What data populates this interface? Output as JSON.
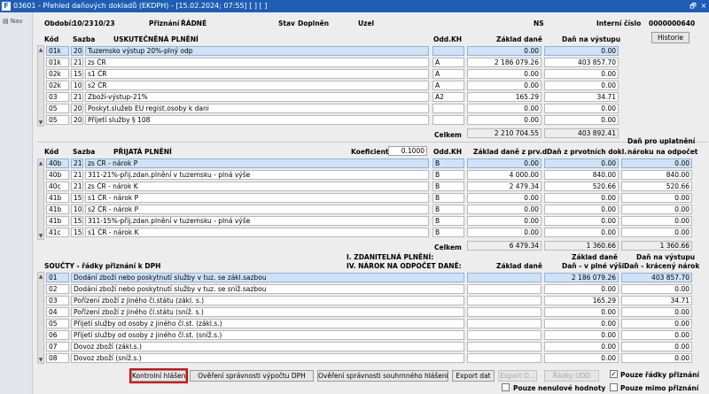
{
  "window": {
    "logo": "F",
    "title": "03601 - Přehled daňových dokladů (EKDPH) - [15.02.2024; 07:55]  [ ]  [ ]",
    "restore_symbol": "🗗",
    "close_symbol": "×"
  },
  "sidebar": {
    "nav_label": "Nav"
  },
  "header": {
    "obdobi_label": "Období:",
    "obdobi_from": "10/23",
    "obdobi_to": "10/23",
    "priznani_label": "Přiznání",
    "priznani_value": "ŘÁDNÉ",
    "stav_label": "Stav",
    "stav_value": "Doplněn",
    "uzel_label": "Uzel",
    "ns_label": "NS",
    "interni_label": "Interní číslo",
    "interni_value": "0000000640",
    "historie_button": "Historie"
  },
  "section1": {
    "col_kod": "Kód",
    "col_sazba": "Sazba",
    "col_title": "USKUTEČNĚNÁ PLNĚNÍ",
    "col_oddkh": "Odd.KH",
    "col_zaklad": "Základ daně",
    "col_dan": "Daň na výstupu",
    "rows": [
      {
        "kod": "01k",
        "sazba": "20",
        "popis": "Tuzemsko výstup 20%-plný odp",
        "odd": "",
        "zaklad": "0.00",
        "dan": "0.00"
      },
      {
        "kod": "01k",
        "sazba": "21",
        "popis": "zs ČR",
        "odd": "A",
        "zaklad": "2 186 079.26",
        "dan": "403 857.70"
      },
      {
        "kod": "02k",
        "sazba": "15",
        "popis": "s1 ČR",
        "odd": "A",
        "zaklad": "0.00",
        "dan": "0.00"
      },
      {
        "kod": "02k",
        "sazba": "10",
        "popis": "s2 ČR",
        "odd": "A",
        "zaklad": "0.00",
        "dan": "0.00"
      },
      {
        "kod": "03",
        "sazba": "21",
        "popis": "Zboží-výstup-21%",
        "odd": "A2",
        "zaklad": "165.29",
        "dan": "34.71"
      },
      {
        "kod": "05",
        "sazba": "20",
        "popis": "Poskyt.služeb EU regist.osoby k dani",
        "odd": "",
        "zaklad": "0.00",
        "dan": "0.00"
      },
      {
        "kod": "05",
        "sazba": "20",
        "popis": "Přijetí služby § 108",
        "odd": "",
        "zaklad": "0.00",
        "dan": "0.00"
      }
    ],
    "celkem_label": "Celkem",
    "celkem_zaklad": "2 210 704.55",
    "celkem_dan": "403 892.41"
  },
  "section2": {
    "col_kod": "Kód",
    "col_sazba": "Sazba",
    "col_title": "PŘIJATÁ PLNĚNÍ",
    "koef_label": "Koeficient",
    "koef_value": "0.1000",
    "col_oddkh": "Odd.KH",
    "col_zaklad": "Základ daně z prv.d.",
    "col_dan": "Daň z prvotních dokl.",
    "col_odpocet_1": "Daň pro uplatnění",
    "col_odpocet_2": "nároku na odpočet",
    "rows": [
      {
        "kod": "40b",
        "sazba": "21",
        "popis": "zs ČR - nárok P",
        "odd": "B",
        "zaklad": "0.00",
        "dan": "0.00",
        "odpocet": "0.00"
      },
      {
        "kod": "40b",
        "sazba": "21",
        "popis": "311-21%-přij.zdan.plnění v tuzemsku - plná výše",
        "odd": "B",
        "zaklad": "4 000.00",
        "dan": "840.00",
        "odpocet": "840.00"
      },
      {
        "kod": "40c",
        "sazba": "21",
        "popis": "zs ČR - nárok K",
        "odd": "B",
        "zaklad": "2 479.34",
        "dan": "520.66",
        "odpocet": "520.66"
      },
      {
        "kod": "41b",
        "sazba": "15",
        "popis": "s1 ČR - nárok P",
        "odd": "B",
        "zaklad": "0.00",
        "dan": "0.00",
        "odpocet": "0.00"
      },
      {
        "kod": "41b",
        "sazba": "10",
        "popis": "s2 ČR - nárok P",
        "odd": "B",
        "zaklad": "0.00",
        "dan": "0.00",
        "odpocet": "0.00"
      },
      {
        "kod": "41b",
        "sazba": "15",
        "popis": "311-15%-přij.zdan.plnění v tuzemsku - plná výše",
        "odd": "B",
        "zaklad": "0.00",
        "dan": "0.00",
        "odpocet": "0.00"
      },
      {
        "kod": "41c",
        "sazba": "15",
        "popis": "s1 ČR - nárok K",
        "odd": "B",
        "zaklad": "0.00",
        "dan": "0.00",
        "odpocet": "0.00"
      }
    ],
    "celkem_label": "Celkem",
    "celkem_zaklad": "6 479.34",
    "celkem_dan": "1 360.66",
    "celkem_odpocet": "1 360.66"
  },
  "section3": {
    "title": "SOUČTY - řádky přiznání k DPH",
    "mid_title_1": "I. ZDANITELNÁ PLNĚNÍ:",
    "mid_title_2": "IV. NÁROK NA ODPOČET DANĚ:",
    "col_zaklad": "Základ daně",
    "col_dan_1": "Základ daně",
    "col_dan_2": "Daň - v plné výši",
    "col_krac_1": "Daň na výstupu",
    "col_krac_2": "Daň - krácený nárok",
    "rows": [
      {
        "kod": "01",
        "popis": "Dodání zboží nebo poskytnutí služby v tuz. se zákl.sazbou",
        "zaklad": "",
        "dan": "2 186 079.26",
        "krac": "403 857.70"
      },
      {
        "kod": "02",
        "popis": "Dodání zboží nebo poskytnutí služby v tuz. se sníž.sazbou",
        "zaklad": "",
        "dan": "0.00",
        "krac": "0.00"
      },
      {
        "kod": "03",
        "popis": "Pořízení zboží z jiného čl.státu (zákl. s.)",
        "zaklad": "",
        "dan": "165.29",
        "krac": "34.71"
      },
      {
        "kod": "04",
        "popis": "Pořízení zboží z jiného čl.státu (sníž. s.)",
        "zaklad": "",
        "dan": "0.00",
        "krac": "0.00"
      },
      {
        "kod": "05",
        "popis": "Přijetí služby od osoby z jiného čl.st. (zákl.s.)",
        "zaklad": "",
        "dan": "0.00",
        "krac": "0.00"
      },
      {
        "kod": "06",
        "popis": "Přijetí služby od osoby z jiného čl.st. (sníž.s.)",
        "zaklad": "",
        "dan": "0.00",
        "krac": "0.00"
      },
      {
        "kod": "07",
        "popis": "Dovoz zboží (zákl.s.)",
        "zaklad": "",
        "dan": "0.00",
        "krac": "0.00"
      },
      {
        "kod": "08",
        "popis": "Dovoz zboží (sníž.s.)",
        "zaklad": "",
        "dan": "0.00",
        "krac": "0.00"
      }
    ]
  },
  "footer": {
    "btn_kontrolni": "Kontrolní hlášení",
    "btn_overeni_vypoctu": "Ověření správnosti výpočtu DPH",
    "btn_overeni_souhrnneho": "Ověření správnosti souhrnného hlášení",
    "btn_export": "Export dat",
    "btn_export_o": "Export O...",
    "btn_radky_udd": "Řádky UDD",
    "chk_pouze_radky": "Pouze řádky přiznání",
    "chk_pouze_radky_checked": "✓",
    "chk_nenulove": "Pouze nenulové hodnoty",
    "chk_mimo": "Pouze mimo přiznání"
  },
  "colors": {
    "titlebar": "#1f5db5",
    "selected_row": "#cfe2f6",
    "highlight": "#e00000"
  }
}
